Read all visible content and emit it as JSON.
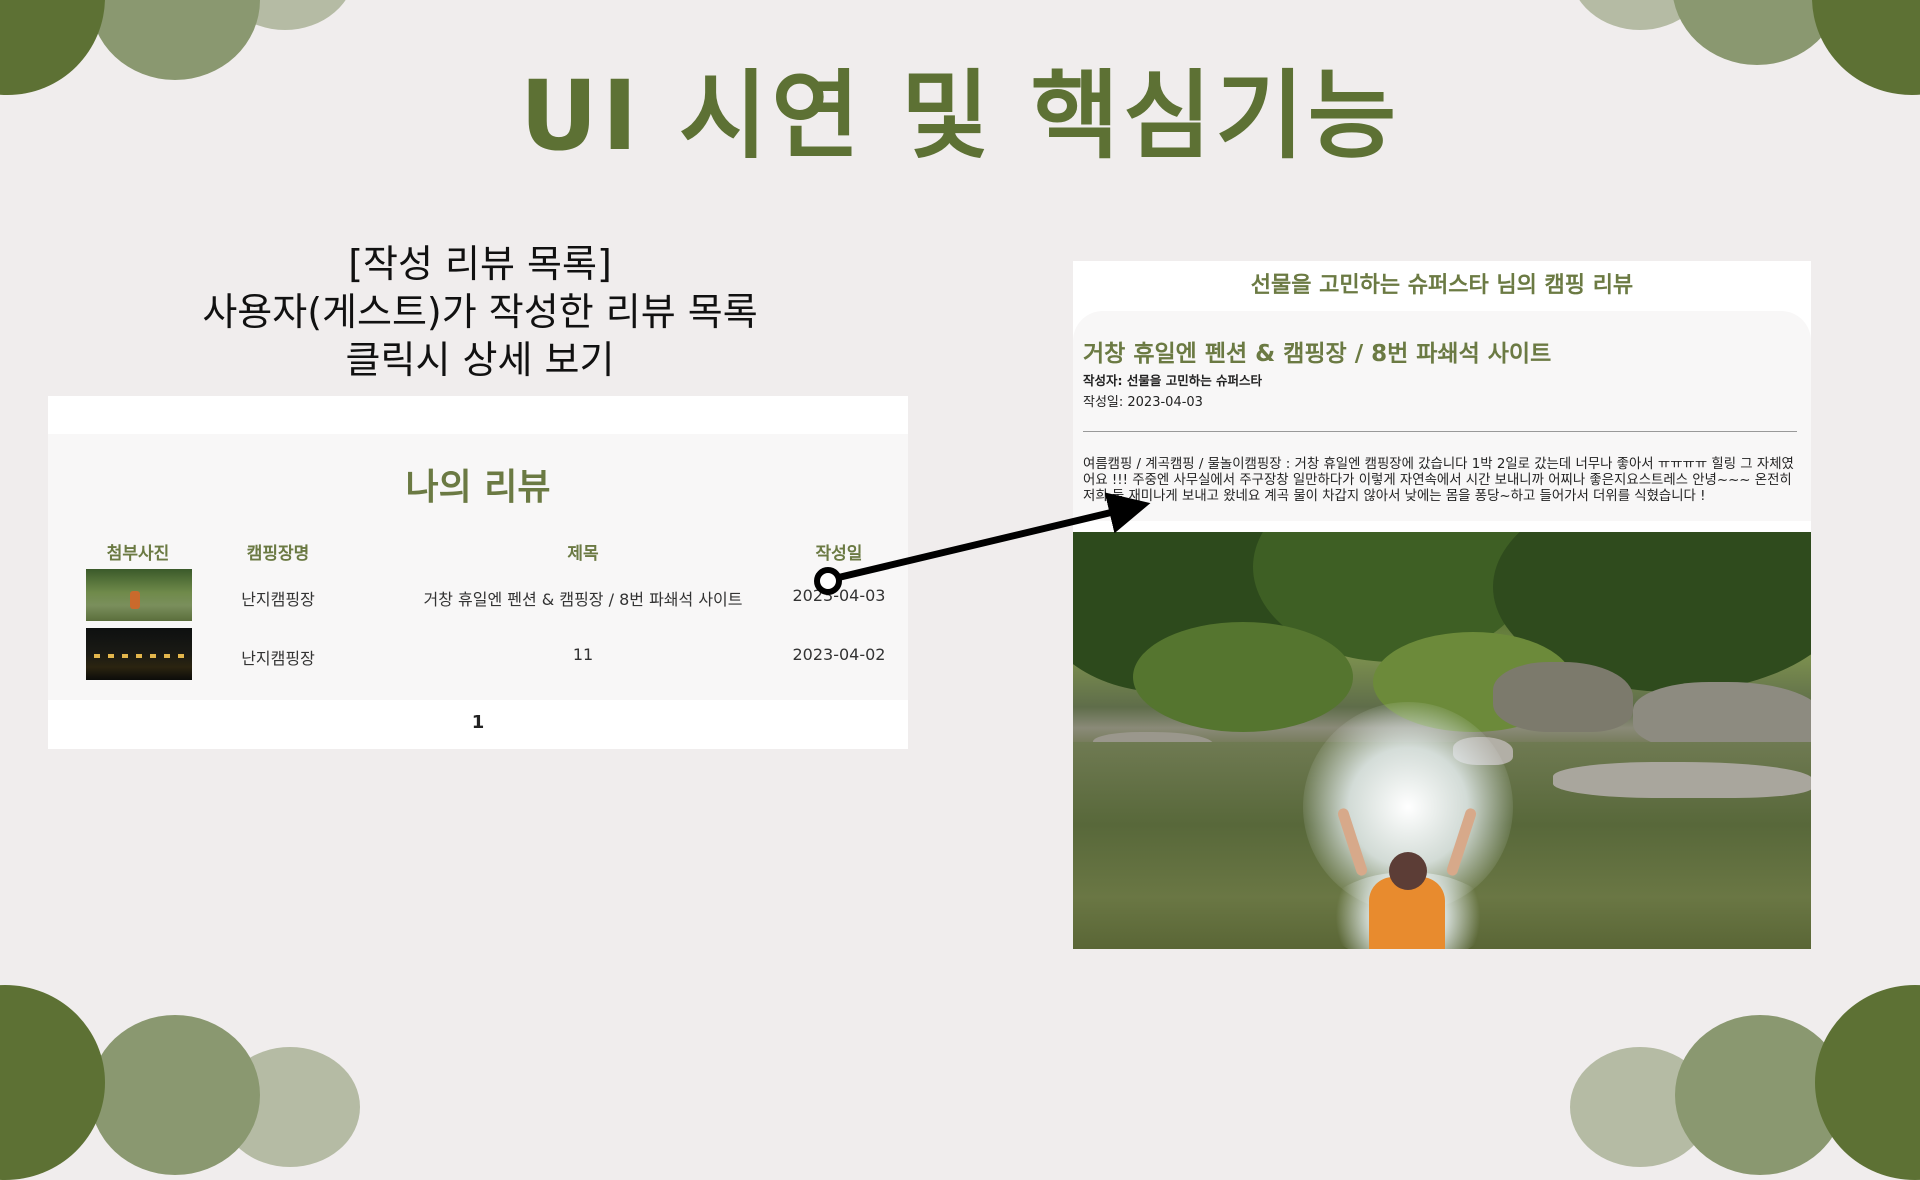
{
  "slide": {
    "title": "UI 시연 및 핵심기능",
    "caption_line1": "[작성 리뷰 목록]",
    "caption_line2": "사용자(게스트)가 작성한 리뷰 목록",
    "caption_line3": "클릭시 상세 보기"
  },
  "review_list": {
    "title": "나의 리뷰",
    "columns": [
      "첨부사진",
      "캠핑장명",
      "제목",
      "작성일"
    ],
    "rows": [
      {
        "camp": "난지캠핑장",
        "title": "거창 휴일엔 펜션 & 캠핑장 / 8번 파쇄석 사이트",
        "date": "2023-04-03"
      },
      {
        "camp": "난지캠핑장",
        "title": "11",
        "date": "2023-04-02"
      }
    ],
    "page": "1"
  },
  "review_detail": {
    "header": "선물을 고민하는 슈퍼스타 님의 캠핑 리뷰",
    "title": "거창 휴일엔 펜션 & 캠핑장 / 8번 파쇄석 사이트",
    "author": "작성자: 선물을 고민하는 슈퍼스타",
    "date": "작성일: 2023-04-03",
    "body": "여름캠핑 / 계곡캠핑 / 물놀이캠핑장 : 거창 휴일엔 캠핑장에 갔습니다 1박 2일로 갔는데 너무나 좋아서 ㅠㅠㅠㅠ 힐링 그 자체였어요 !!! 주중엔 사무실에서 주구장창 일만하다가 이렇게 자연속에서 시간 보내니까 어찌나 좋은지요스트레스 안녕~~~ 온전히 저희 둘 재미나게 보내고 왔네요 계곡 물이 차갑지 않아서 낮에는 몸을 퐁당~하고 들어가서 더위를 식혔습니다 !"
  },
  "colors": {
    "accent": "#5d7134",
    "accent_light": "#6b7a43",
    "background": "#f0eded"
  }
}
